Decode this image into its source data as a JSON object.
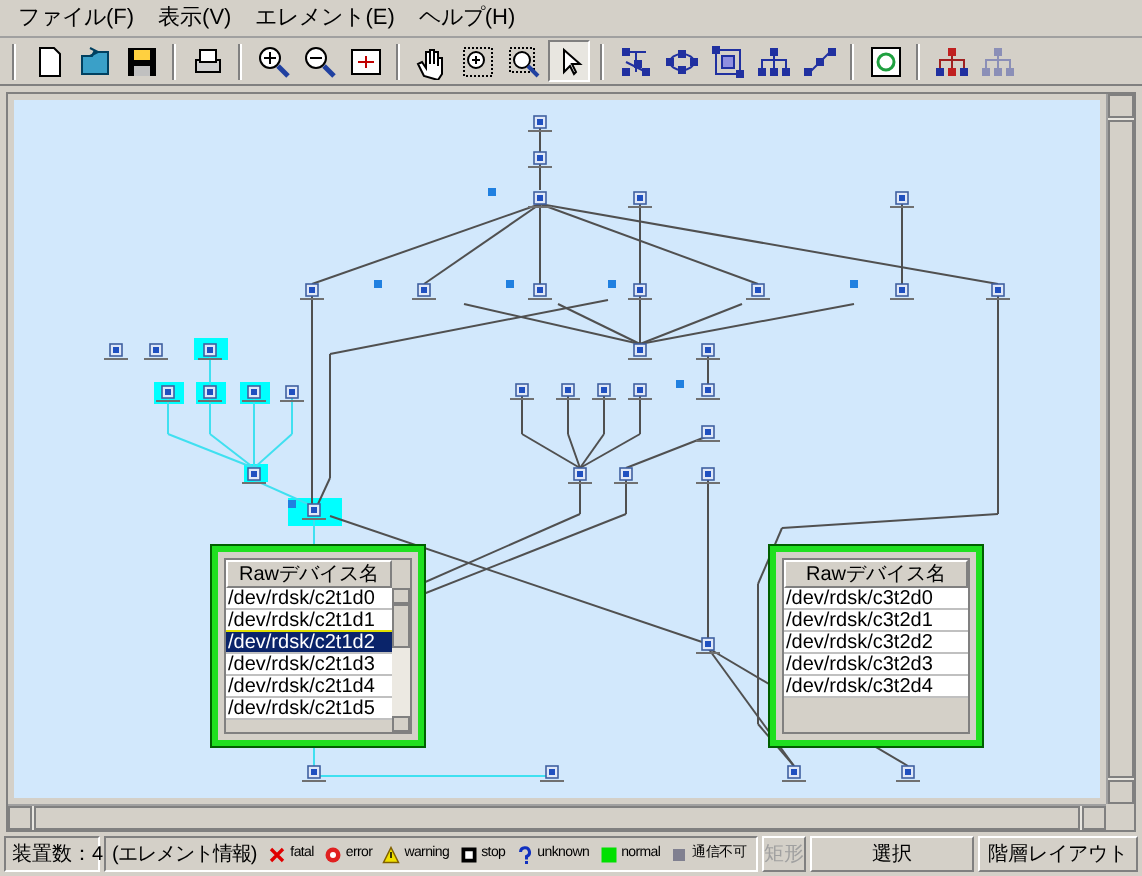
{
  "menu": [
    {
      "label": "ファイル(F)"
    },
    {
      "label": "表示(V)"
    },
    {
      "label": "エレメント(E)"
    },
    {
      "label": "ヘルプ(H)"
    }
  ],
  "toolbar": [
    {
      "kind": "new",
      "selected": false
    },
    {
      "kind": "open",
      "selected": false
    },
    {
      "kind": "save",
      "selected": false
    },
    {
      "kind": "separator"
    },
    {
      "kind": "print",
      "selected": false
    },
    {
      "kind": "separator"
    },
    {
      "kind": "zoom-in",
      "selected": false
    },
    {
      "kind": "zoom-out",
      "selected": false
    },
    {
      "kind": "fit",
      "selected": false
    },
    {
      "kind": "separator"
    },
    {
      "kind": "hand",
      "selected": false
    },
    {
      "kind": "zoom-area",
      "selected": false
    },
    {
      "kind": "zoom-window",
      "selected": false
    },
    {
      "kind": "pointer",
      "selected": true
    },
    {
      "kind": "separator"
    },
    {
      "kind": "tree",
      "selected": false
    },
    {
      "kind": "ring",
      "selected": false
    },
    {
      "kind": "box",
      "selected": false
    },
    {
      "kind": "hierarchy",
      "selected": false
    },
    {
      "kind": "diagonal",
      "selected": false
    },
    {
      "kind": "separator"
    },
    {
      "kind": "refresh",
      "selected": false
    },
    {
      "kind": "separator"
    },
    {
      "kind": "tree-red",
      "selected": false
    },
    {
      "kind": "tree-disabled",
      "selected": false,
      "disabled": true
    }
  ],
  "tables": [
    {
      "header": "Rawデバイス名",
      "scrollbar": true,
      "rows": [
        {
          "text": "/dev/rdsk/c2t1d0",
          "selected": false
        },
        {
          "text": "/dev/rdsk/c2t1d1",
          "selected": false
        },
        {
          "text": "/dev/rdsk/c2t1d2",
          "selected": true
        },
        {
          "text": "/dev/rdsk/c2t1d3",
          "selected": false
        },
        {
          "text": "/dev/rdsk/c2t1d4",
          "selected": false
        },
        {
          "text": "/dev/rdsk/c2t1d5",
          "selected": false
        }
      ]
    },
    {
      "header": "Rawデバイス名",
      "scrollbar": false,
      "rows": [
        {
          "text": "/dev/rdsk/c3t2d0",
          "selected": false
        },
        {
          "text": "/dev/rdsk/c3t2d1",
          "selected": false
        },
        {
          "text": "/dev/rdsk/c3t2d2",
          "selected": false
        },
        {
          "text": "/dev/rdsk/c3t2d3",
          "selected": false
        },
        {
          "text": "/dev/rdsk/c3t2d4",
          "selected": false
        }
      ]
    }
  ],
  "status_bar": {
    "device_count": "装置数：4",
    "element_info": "(エレメント情報)",
    "legend": [
      {
        "kind": "fatal",
        "label": "fatal"
      },
      {
        "kind": "error",
        "label": "error"
      },
      {
        "kind": "warning",
        "label": "warning"
      },
      {
        "kind": "stop",
        "label": "stop"
      },
      {
        "kind": "unknown",
        "label": "unknown"
      },
      {
        "kind": "normal",
        "label": "normal"
      },
      {
        "kind": "unreachable",
        "label": "通信不可"
      }
    ],
    "buttons": [
      {
        "label": "矩形",
        "disabled": true
      },
      {
        "label": "選択",
        "disabled": false
      },
      {
        "label": "階層レイアウト",
        "disabled": false
      }
    ]
  }
}
